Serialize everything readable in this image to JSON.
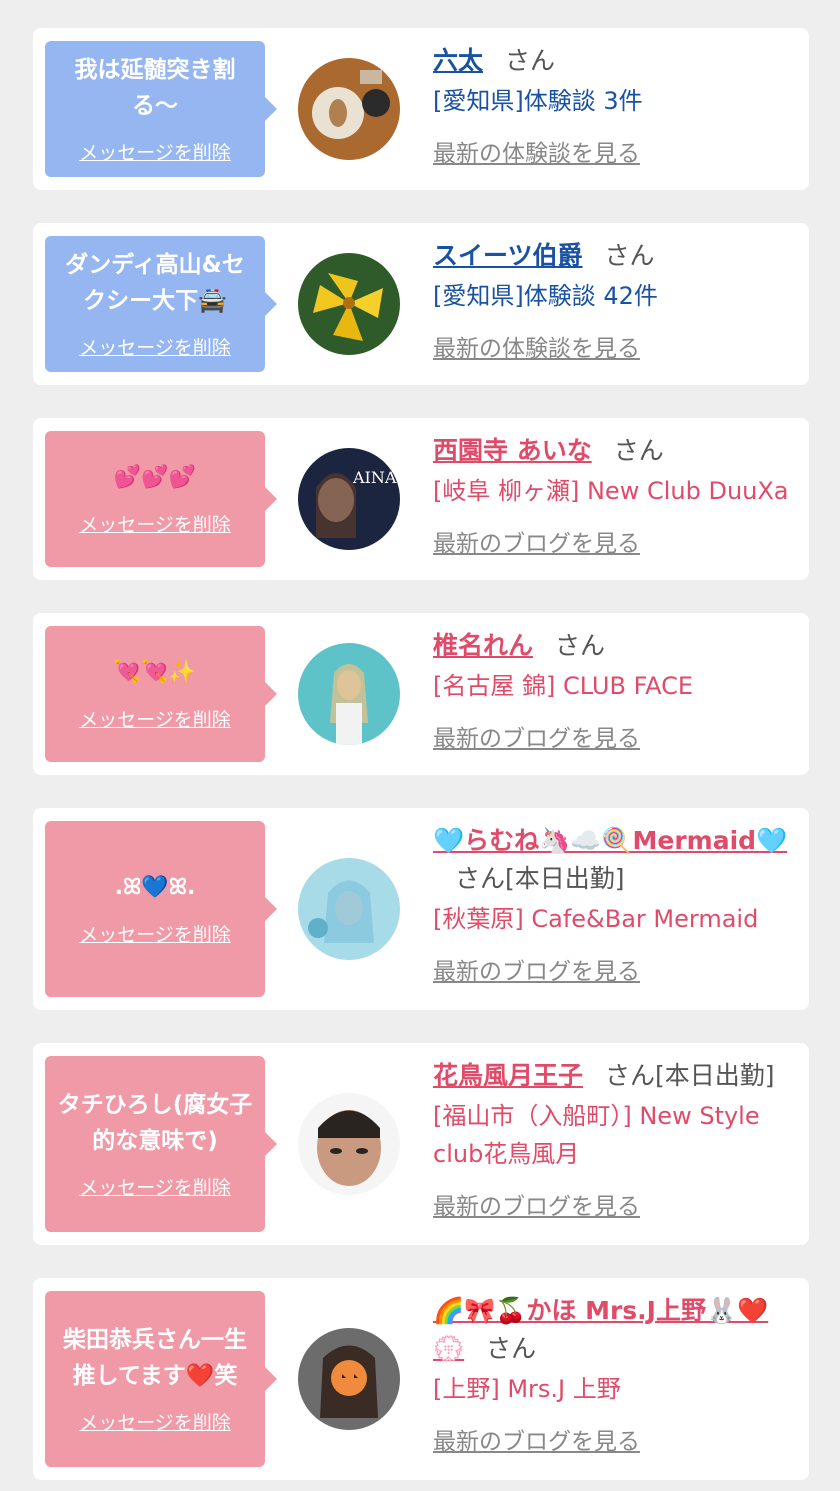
{
  "delete_label": "メッセージを削除",
  "san": "さん",
  "items": [
    {
      "message": "我は延髄突き割る〜",
      "name": "六太",
      "suffix": "",
      "sub": "[愛知県]体験談 3件",
      "more": "最新の体験談を見る",
      "type": "blue"
    },
    {
      "message": "ダンディ高山&セクシー大下🚔",
      "name": "スイーツ伯爵",
      "suffix": "",
      "sub": "[愛知県]体験談 42件",
      "more": "最新の体験談を見る",
      "type": "blue"
    },
    {
      "message": "💕💕💕",
      "name": "西園寺 あいな",
      "suffix": "",
      "sub": "[岐阜 柳ヶ瀬] New Club DuuXa",
      "more": "最新のブログを見る",
      "type": "pink"
    },
    {
      "message": "💘💘✨",
      "name": "椎名れん",
      "suffix": "",
      "sub": "[名古屋 錦] CLUB FACE",
      "more": "最新のブログを見る",
      "type": "pink"
    },
    {
      "message": ".ꕤ💙ꕤ.",
      "name": "🩵らむね🦄☁️🍭Mermaid🩵",
      "suffix": "[本日出勤]",
      "sub": "[秋葉原] Cafe&Bar Mermaid",
      "more": "最新のブログを見る",
      "type": "pink"
    },
    {
      "message": "タチひろし(腐女子的な意味で)",
      "name": "花鳥風月王子",
      "suffix": "[本日出勤]",
      "sub": "[福山市（入船町）] New Style club花鳥風月",
      "more": "最新のブログを見る",
      "type": "pink"
    },
    {
      "message": "柴田恭兵さん一生推してます❤️笑",
      "name": "🌈🎀🍒かほ Mrs.J上野🐰❤️💮",
      "suffix": "",
      "sub": "[上野] Mrs.J 上野",
      "more": "最新のブログを見る",
      "type": "pink"
    }
  ],
  "colors": {
    "blue_bubble": "#95b6f0",
    "pink_bubble": "#f09aa7",
    "blue_text": "#1a52a3",
    "pink_text": "#e04b6a"
  }
}
